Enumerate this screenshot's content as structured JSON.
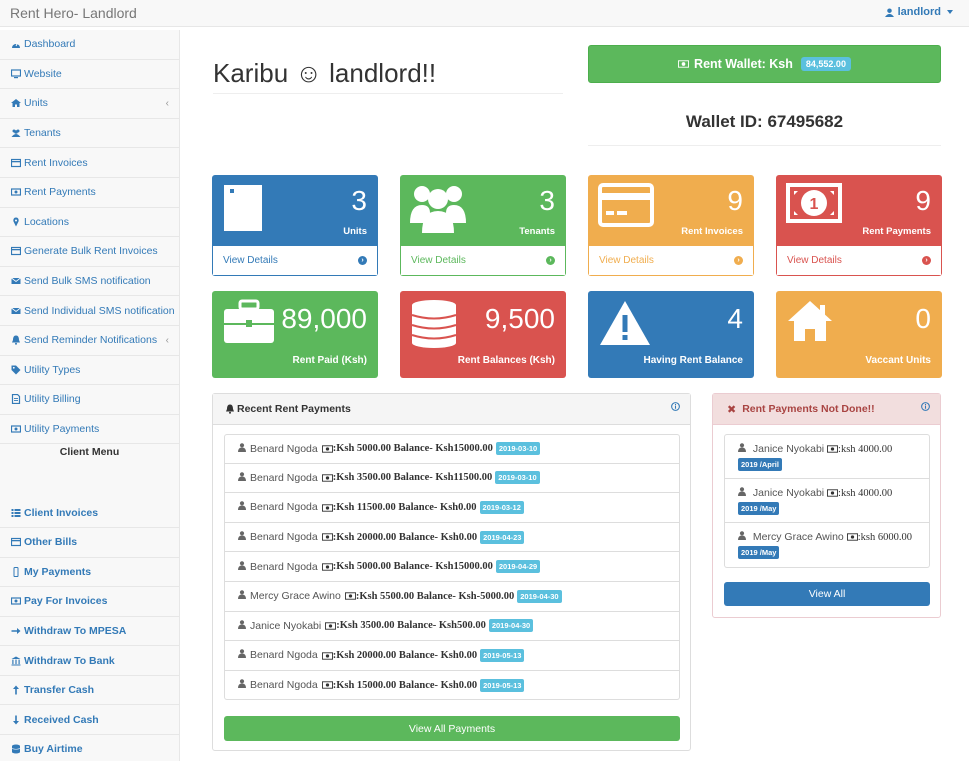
{
  "navbar": {
    "brand": "Rent Hero- Landlord",
    "user": "landlord"
  },
  "sidebar": {
    "items": [
      {
        "label": "Dashboard",
        "icon": "dashboard-icon"
      },
      {
        "label": "Website",
        "icon": "desktop-icon"
      },
      {
        "label": "Units",
        "icon": "home-icon",
        "has_submenu": true
      },
      {
        "label": "Tenants",
        "icon": "users-icon"
      },
      {
        "label": "Rent Invoices",
        "icon": "invoice-icon"
      },
      {
        "label": "Rent Payments",
        "icon": "money-icon"
      },
      {
        "label": "Locations",
        "icon": "map-marker-icon"
      },
      {
        "label": "Generate Bulk Rent Invoices",
        "icon": "invoice-icon"
      },
      {
        "label": "Send Bulk SMS notification",
        "icon": "envelope-icon"
      },
      {
        "label": "Send Individual SMS notification",
        "icon": "envelope-icon"
      },
      {
        "label": "Send Reminder Notifications",
        "icon": "bell-icon",
        "has_submenu": true
      },
      {
        "label": "Utility Types",
        "icon": "tags-icon"
      },
      {
        "label": "Utility Billing",
        "icon": "file-icon"
      },
      {
        "label": "Utility Payments",
        "icon": "money-icon"
      }
    ],
    "client_menu_title": "Client Menu",
    "client_items": [
      {
        "label": "Client Invoices",
        "icon": "list-icon"
      },
      {
        "label": "Other Bills",
        "icon": "invoice-icon"
      },
      {
        "label": "My Payments",
        "icon": "mobile-icon"
      },
      {
        "label": "Pay For Invoices",
        "icon": "money-icon"
      },
      {
        "label": "Withdraw To MPESA",
        "icon": "arrow-right-icon"
      },
      {
        "label": "Withdraw To Bank",
        "icon": "bank-icon"
      },
      {
        "label": "Transfer Cash",
        "icon": "arrow-up-icon"
      },
      {
        "label": "Received Cash",
        "icon": "arrow-down-icon"
      },
      {
        "label": "Buy Airtime",
        "icon": "database-icon"
      }
    ]
  },
  "main": {
    "welcome": "Karibu ☺ landlord!!",
    "wallet": {
      "label": "Rent Wallet: Ksh",
      "amount": "84,552.00",
      "id_text": "Wallet ID: 67495682"
    },
    "cards": [
      {
        "value": "3",
        "label": "Units",
        "footer": "View Details",
        "color": "#337ab7",
        "icon": "building-icon"
      },
      {
        "value": "3",
        "label": "Tenants",
        "footer": "View Details",
        "color": "#5cb85c",
        "icon": "users-icon"
      },
      {
        "value": "9",
        "label": "Rent Invoices",
        "footer": "View Details",
        "color": "#f0ad4e",
        "icon": "credit-card-icon"
      },
      {
        "value": "9",
        "label": "Rent Payments",
        "footer": "View Details",
        "color": "#d9534f",
        "icon": "money-icon"
      }
    ],
    "stats": [
      {
        "value": "89,000",
        "label": "Rent Paid (Ksh)",
        "color": "#5cb85c",
        "icon": "briefcase-icon"
      },
      {
        "value": "9,500",
        "label": "Rent Balances (Ksh)",
        "color": "#d9534f",
        "icon": "database-icon"
      },
      {
        "value": "4",
        "label": "Having Rent Balance",
        "color": "#337ab7",
        "icon": "warning-icon"
      },
      {
        "value": "0",
        "label": "Vaccant Units",
        "color": "#f0ad4e",
        "icon": "home-icon"
      }
    ],
    "recent": {
      "title": "Recent Rent Payments",
      "rows": [
        {
          "name": "Benard Ngoda",
          "detail": ":Ksh 5000.00 Balance- Ksh15000.00",
          "date": "2019-03-10"
        },
        {
          "name": "Benard Ngoda",
          "detail": ":Ksh 3500.00 Balance- Ksh11500.00",
          "date": "2019-03-10"
        },
        {
          "name": "Benard Ngoda",
          "detail": ":Ksh 11500.00 Balance- Ksh0.00",
          "date": "2019-03-12"
        },
        {
          "name": "Benard Ngoda",
          "detail": ":Ksh 20000.00 Balance- Ksh0.00",
          "date": "2019-04-23"
        },
        {
          "name": "Benard Ngoda",
          "detail": ":Ksh 5000.00 Balance- Ksh15000.00",
          "date": "2019-04-29"
        },
        {
          "name": "Mercy Grace Awino",
          "detail": ":Ksh 5500.00 Balance- Ksh-5000.00",
          "date": "2019-04-30"
        },
        {
          "name": "Janice Nyokabi",
          "detail": ":Ksh 3500.00 Balance- Ksh500.00",
          "date": "2019-04-30"
        },
        {
          "name": "Benard Ngoda",
          "detail": ":Ksh 20000.00 Balance- Ksh0.00",
          "date": "2019-05-13"
        },
        {
          "name": "Benard Ngoda",
          "detail": ":Ksh 15000.00 Balance- Ksh0.00",
          "date": "2019-05-13"
        }
      ],
      "button": "View All Payments"
    },
    "not_done": {
      "title": "Rent Payments Not Done!!",
      "rows": [
        {
          "name": "Janice Nyokabi",
          "amount": ":ksh 4000.00",
          "period": "2019 /April"
        },
        {
          "name": "Janice Nyokabi",
          "amount": ":ksh 4000.00",
          "period": "2019 /May"
        },
        {
          "name": "Mercy Grace Awino",
          "amount": ":ksh 6000.00",
          "period": "2019 /May"
        }
      ],
      "button": "View All"
    }
  }
}
